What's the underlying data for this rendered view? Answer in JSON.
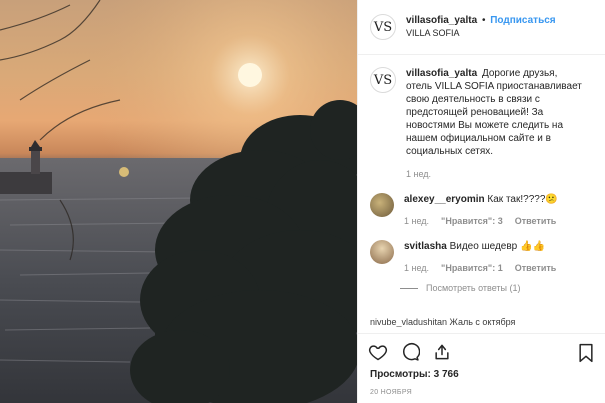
{
  "header": {
    "username": "villasofia_yalta",
    "dot": "•",
    "follow_label": "Подписаться",
    "location": "VILLA SOFIA",
    "avatar_glyph": "VS"
  },
  "caption": {
    "username": "villasofia_yalta",
    "text": "Дорогие друзья, отель VILLA SOFIA приостанавливает свою деятельность в связи с предстоящей реновацией! За новостями Вы можете следить на нашем официальном сайте и в социальных сетях.",
    "time": "1 нед."
  },
  "comments": [
    {
      "username": "alexey__eryomin",
      "text": "Как так!????😕",
      "time": "1 нед.",
      "likes": "\"Нравится\": 3",
      "reply": "Ответить"
    },
    {
      "username": "svitlasha",
      "text": "Видео шедевр 👍👍",
      "time": "1 нед.",
      "likes": "\"Нравится\": 1",
      "reply": "Ответить",
      "view_replies": "Посмотреть ответы (1)"
    }
  ],
  "partial_comment": "nivube_vladushitan Жаль с октября",
  "stats": {
    "views_label": "Просмотры: 3 766",
    "date": "20 НОЯБРЯ"
  },
  "colors": {
    "accent": "#3897f0",
    "muted": "#8e8e8e"
  },
  "icons": [
    "heart-icon",
    "comment-icon",
    "share-icon",
    "bookmark-icon"
  ]
}
